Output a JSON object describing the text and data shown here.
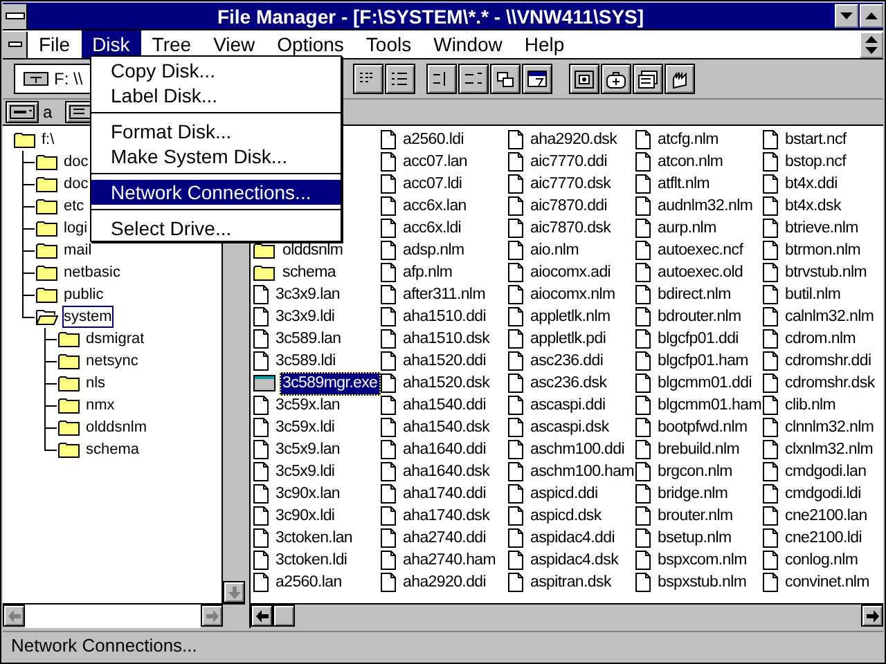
{
  "window": {
    "title": "File Manager - [F:\\SYSTEM\\*.* - \\\\VNW411\\SYS]"
  },
  "menu_bar": [
    {
      "label": "File",
      "selected": false
    },
    {
      "label": "Disk",
      "selected": true
    },
    {
      "label": "Tree",
      "selected": false
    },
    {
      "label": "View",
      "selected": false
    },
    {
      "label": "Options",
      "selected": false
    },
    {
      "label": "Tools",
      "selected": false
    },
    {
      "label": "Window",
      "selected": false
    },
    {
      "label": "Help",
      "selected": false
    }
  ],
  "disk_menu": [
    {
      "kind": "item",
      "label": "Copy Disk...",
      "selected": false
    },
    {
      "kind": "item",
      "label": "Label Disk...",
      "selected": false
    },
    {
      "kind": "separator"
    },
    {
      "kind": "item",
      "label": "Format Disk...",
      "selected": false
    },
    {
      "kind": "item",
      "label": "Make System Disk...",
      "selected": false
    },
    {
      "kind": "separator"
    },
    {
      "kind": "item",
      "label": "Network Connections...",
      "selected": true
    },
    {
      "kind": "separator"
    },
    {
      "kind": "item",
      "label": "Select Drive...",
      "selected": false
    }
  ],
  "toolbar": {
    "drive": "F: \\\\"
  },
  "drive_bar": [
    {
      "label": "a"
    }
  ],
  "tree": {
    "label": "f:\\",
    "selected": false,
    "children": [
      {
        "label": "doc",
        "selected": false
      },
      {
        "label": "doc",
        "selected": false
      },
      {
        "label": "etc",
        "selected": false
      },
      {
        "label": "logi",
        "selected": false
      },
      {
        "label": "mail",
        "selected": false
      },
      {
        "label": "netbasic",
        "selected": false
      },
      {
        "label": "public",
        "selected": false
      },
      {
        "label": "system",
        "selected": true,
        "children": [
          {
            "label": "dsmigrat",
            "selected": false
          },
          {
            "label": "netsync",
            "selected": false
          },
          {
            "label": "nls",
            "selected": false
          },
          {
            "label": "nmx",
            "selected": false
          },
          {
            "label": "olddsnlm",
            "selected": false
          },
          {
            "label": "schema",
            "selected": false
          }
        ]
      }
    ]
  },
  "file_columns": [
    [
      {
        "name": "olddsnlm",
        "kind": "folder",
        "selected": false
      },
      {
        "name": "schema",
        "kind": "folder",
        "selected": false
      },
      {
        "name": "3c3x9.lan",
        "kind": "file",
        "selected": false
      },
      {
        "name": "3c3x9.ldi",
        "kind": "file",
        "selected": false
      },
      {
        "name": "3c589.lan",
        "kind": "file",
        "selected": false
      },
      {
        "name": "3c589.ldi",
        "kind": "file",
        "selected": false
      },
      {
        "name": "3c589mgr.exe",
        "kind": "program",
        "selected": true
      },
      {
        "name": "3c59x.lan",
        "kind": "file",
        "selected": false
      },
      {
        "name": "3c59x.ldi",
        "kind": "file",
        "selected": false
      },
      {
        "name": "3c5x9.lan",
        "kind": "file",
        "selected": false
      },
      {
        "name": "3c5x9.ldi",
        "kind": "file",
        "selected": false
      },
      {
        "name": "3c90x.lan",
        "kind": "file",
        "selected": false
      },
      {
        "name": "3c90x.ldi",
        "kind": "file",
        "selected": false
      },
      {
        "name": "3ctoken.lan",
        "kind": "file",
        "selected": false
      },
      {
        "name": "3ctoken.ldi",
        "kind": "file",
        "selected": false
      },
      {
        "name": "a2560.lan",
        "kind": "file",
        "selected": false
      }
    ],
    [
      {
        "name": "a2560.ldi",
        "kind": "file",
        "selected": false
      },
      {
        "name": "acc07.lan",
        "kind": "file",
        "selected": false
      },
      {
        "name": "acc07.ldi",
        "kind": "file",
        "selected": false
      },
      {
        "name": "acc6x.lan",
        "kind": "file",
        "selected": false
      },
      {
        "name": "acc6x.ldi",
        "kind": "file",
        "selected": false
      },
      {
        "name": "adsp.nlm",
        "kind": "file",
        "selected": false
      },
      {
        "name": "afp.nlm",
        "kind": "file",
        "selected": false
      },
      {
        "name": "after311.nlm",
        "kind": "file",
        "selected": false
      },
      {
        "name": "aha1510.ddi",
        "kind": "file",
        "selected": false
      },
      {
        "name": "aha1510.dsk",
        "kind": "file",
        "selected": false
      },
      {
        "name": "aha1520.ddi",
        "kind": "file",
        "selected": false
      },
      {
        "name": "aha1520.dsk",
        "kind": "file",
        "selected": false
      },
      {
        "name": "aha1540.ddi",
        "kind": "file",
        "selected": false
      },
      {
        "name": "aha1540.dsk",
        "kind": "file",
        "selected": false
      },
      {
        "name": "aha1640.ddi",
        "kind": "file",
        "selected": false
      },
      {
        "name": "aha1640.dsk",
        "kind": "file",
        "selected": false
      },
      {
        "name": "aha1740.ddi",
        "kind": "file",
        "selected": false
      },
      {
        "name": "aha1740.dsk",
        "kind": "file",
        "selected": false
      },
      {
        "name": "aha2740.ddi",
        "kind": "file",
        "selected": false
      },
      {
        "name": "aha2740.ham",
        "kind": "file",
        "selected": false
      },
      {
        "name": "aha2920.ddi",
        "kind": "file",
        "selected": false
      }
    ],
    [
      {
        "name": "aha2920.dsk",
        "kind": "file",
        "selected": false
      },
      {
        "name": "aic7770.ddi",
        "kind": "file",
        "selected": false
      },
      {
        "name": "aic7770.dsk",
        "kind": "file",
        "selected": false
      },
      {
        "name": "aic7870.ddi",
        "kind": "file",
        "selected": false
      },
      {
        "name": "aic7870.dsk",
        "kind": "file",
        "selected": false
      },
      {
        "name": "aio.nlm",
        "kind": "file",
        "selected": false
      },
      {
        "name": "aiocomx.adi",
        "kind": "file",
        "selected": false
      },
      {
        "name": "aiocomx.nlm",
        "kind": "file",
        "selected": false
      },
      {
        "name": "appletlk.nlm",
        "kind": "file",
        "selected": false
      },
      {
        "name": "appletlk.pdi",
        "kind": "file",
        "selected": false
      },
      {
        "name": "asc236.ddi",
        "kind": "file",
        "selected": false
      },
      {
        "name": "asc236.dsk",
        "kind": "file",
        "selected": false
      },
      {
        "name": "ascaspi.ddi",
        "kind": "file",
        "selected": false
      },
      {
        "name": "ascaspi.dsk",
        "kind": "file",
        "selected": false
      },
      {
        "name": "aschm100.ddi",
        "kind": "file",
        "selected": false
      },
      {
        "name": "aschm100.ham",
        "kind": "file",
        "selected": false
      },
      {
        "name": "aspicd.ddi",
        "kind": "file",
        "selected": false
      },
      {
        "name": "aspicd.dsk",
        "kind": "file",
        "selected": false
      },
      {
        "name": "aspidac4.ddi",
        "kind": "file",
        "selected": false
      },
      {
        "name": "aspidac4.dsk",
        "kind": "file",
        "selected": false
      },
      {
        "name": "aspitran.dsk",
        "kind": "file",
        "selected": false
      }
    ],
    [
      {
        "name": "atcfg.nlm",
        "kind": "file",
        "selected": false
      },
      {
        "name": "atcon.nlm",
        "kind": "file",
        "selected": false
      },
      {
        "name": "atflt.nlm",
        "kind": "file",
        "selected": false
      },
      {
        "name": "audnlm32.nlm",
        "kind": "file",
        "selected": false
      },
      {
        "name": "aurp.nlm",
        "kind": "file",
        "selected": false
      },
      {
        "name": "autoexec.ncf",
        "kind": "file",
        "selected": false
      },
      {
        "name": "autoexec.old",
        "kind": "file",
        "selected": false
      },
      {
        "name": "bdirect.nlm",
        "kind": "file",
        "selected": false
      },
      {
        "name": "bdrouter.nlm",
        "kind": "file",
        "selected": false
      },
      {
        "name": "blgcfp01.ddi",
        "kind": "file",
        "selected": false
      },
      {
        "name": "blgcfp01.ham",
        "kind": "file",
        "selected": false
      },
      {
        "name": "blgcmm01.ddi",
        "kind": "file",
        "selected": false
      },
      {
        "name": "blgcmm01.ham",
        "kind": "file",
        "selected": false
      },
      {
        "name": "bootpfwd.nlm",
        "kind": "file",
        "selected": false
      },
      {
        "name": "brebuild.nlm",
        "kind": "file",
        "selected": false
      },
      {
        "name": "brgcon.nlm",
        "kind": "file",
        "selected": false
      },
      {
        "name": "bridge.nlm",
        "kind": "file",
        "selected": false
      },
      {
        "name": "brouter.nlm",
        "kind": "file",
        "selected": false
      },
      {
        "name": "bsetup.nlm",
        "kind": "file",
        "selected": false
      },
      {
        "name": "bspxcom.nlm",
        "kind": "file",
        "selected": false
      },
      {
        "name": "bspxstub.nlm",
        "kind": "file",
        "selected": false
      }
    ],
    [
      {
        "name": "bstart.ncf",
        "kind": "file",
        "selected": false
      },
      {
        "name": "bstop.ncf",
        "kind": "file",
        "selected": false
      },
      {
        "name": "bt4x.ddi",
        "kind": "file",
        "selected": false
      },
      {
        "name": "bt4x.dsk",
        "kind": "file",
        "selected": false
      },
      {
        "name": "btrieve.nlm",
        "kind": "file",
        "selected": false
      },
      {
        "name": "btrmon.nlm",
        "kind": "file",
        "selected": false
      },
      {
        "name": "btrvstub.nlm",
        "kind": "file",
        "selected": false
      },
      {
        "name": "butil.nlm",
        "kind": "file",
        "selected": false
      },
      {
        "name": "calnlm32.nlm",
        "kind": "file",
        "selected": false
      },
      {
        "name": "cdrom.nlm",
        "kind": "file",
        "selected": false
      },
      {
        "name": "cdromshr.ddi",
        "kind": "file",
        "selected": false
      },
      {
        "name": "cdromshr.dsk",
        "kind": "file",
        "selected": false
      },
      {
        "name": "clib.nlm",
        "kind": "file",
        "selected": false
      },
      {
        "name": "clnnlm32.nlm",
        "kind": "file",
        "selected": false
      },
      {
        "name": "clxnlm32.nlm",
        "kind": "file",
        "selected": false
      },
      {
        "name": "cmdgodi.lan",
        "kind": "file",
        "selected": false
      },
      {
        "name": "cmdgodi.ldi",
        "kind": "file",
        "selected": false
      },
      {
        "name": "cne2100.lan",
        "kind": "file",
        "selected": false
      },
      {
        "name": "cne2100.ldi",
        "kind": "file",
        "selected": false
      },
      {
        "name": "conlog.nlm",
        "kind": "file",
        "selected": false
      },
      {
        "name": "convinet.nlm",
        "kind": "file",
        "selected": false
      }
    ]
  ],
  "status_bar": "Network Connections..."
}
